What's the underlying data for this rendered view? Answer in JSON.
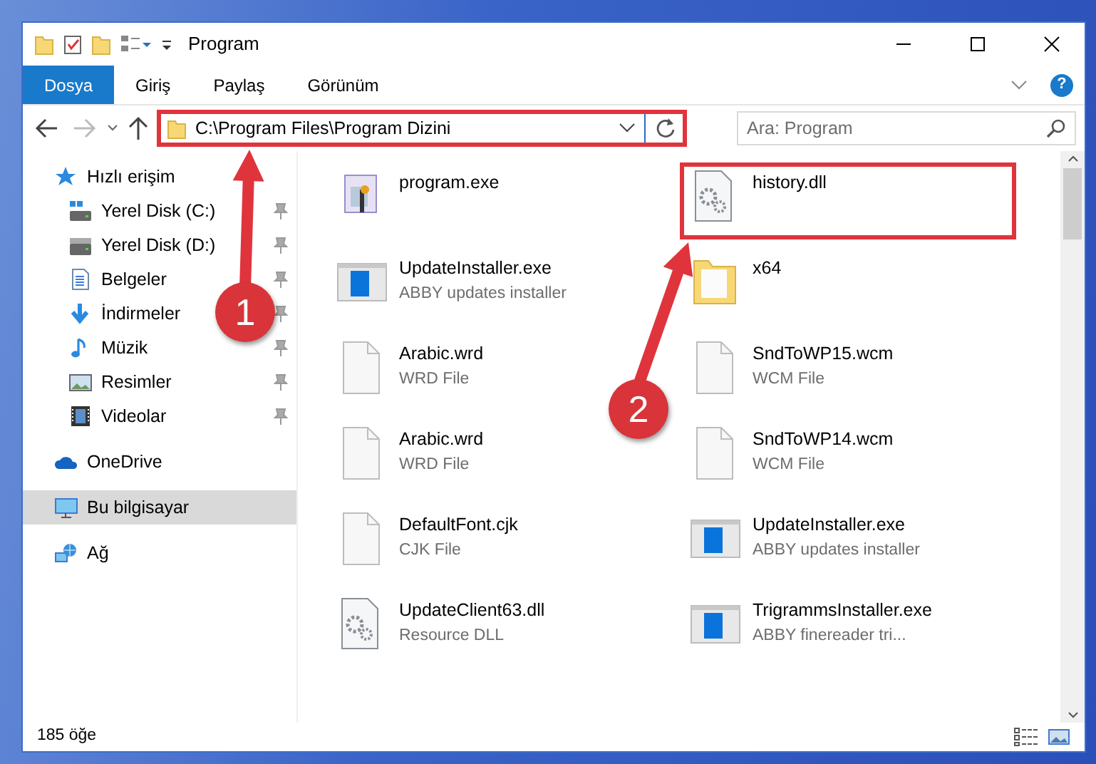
{
  "window": {
    "title": "Program",
    "help": "?"
  },
  "ribbon_tabs": [
    {
      "label": "Dosya",
      "selected": true
    },
    {
      "label": "Giriş",
      "selected": false
    },
    {
      "label": "Paylaş",
      "selected": false
    },
    {
      "label": "Görünüm",
      "selected": false
    }
  ],
  "address": {
    "path": "C:\\Program Files\\Program Dizini",
    "highlighted": true
  },
  "search": {
    "placeholder": "Ara: Program"
  },
  "sidebar": {
    "items": [
      {
        "label": "Hızlı erişim",
        "kind": "star",
        "selected": false,
        "children": [
          {
            "label": "Yerel Disk (C:)",
            "kind": "drive-c",
            "selected": false,
            "pinned": true
          },
          {
            "label": "Yerel Disk (D:)",
            "kind": "drive",
            "selected": false,
            "pinned": true
          },
          {
            "label": "Belgeler",
            "kind": "documents",
            "selected": false,
            "pinned": true
          },
          {
            "label": "İndirmeler",
            "kind": "download",
            "selected": false,
            "pinned": true
          },
          {
            "label": "Müzik",
            "kind": "music",
            "selected": false,
            "pinned": true
          },
          {
            "label": "Resimler",
            "kind": "pictures",
            "selected": false,
            "pinned": true
          },
          {
            "label": "Videolar",
            "kind": "videos",
            "selected": false,
            "pinned": true
          }
        ]
      },
      {
        "label": "OneDrive",
        "kind": "cloud",
        "selected": false
      },
      {
        "label": "Bu bilgisayar",
        "kind": "computer",
        "selected": true
      },
      {
        "label": "Ağ",
        "kind": "network",
        "selected": false
      }
    ]
  },
  "files": [
    {
      "name": "program.exe",
      "kind": "app",
      "highlighted": false
    },
    {
      "name": "history.dll",
      "kind": "gear-file",
      "highlighted": true
    },
    {
      "name": "UpdateInstaller.exe",
      "type": "ABBY updates installer",
      "kind": "installer",
      "highlighted": false
    },
    {
      "name": "x64",
      "kind": "folder",
      "highlighted": false
    },
    {
      "name": "Arabic.wrd",
      "type": "WRD File",
      "kind": "file",
      "highlighted": false
    },
    {
      "name": "SndToWP15.wcm",
      "type": "WCM File",
      "kind": "file",
      "highlighted": false
    },
    {
      "name": "Arabic.wrd",
      "type": "WRD File",
      "kind": "file",
      "highlighted": false
    },
    {
      "name": "SndToWP14.wcm",
      "type": "WCM File",
      "kind": "file",
      "highlighted": false
    },
    {
      "name": "DefaultFont.cjk",
      "type": "CJK File",
      "kind": "file",
      "highlighted": false
    },
    {
      "name": "UpdateInstaller.exe",
      "type": "ABBY updates installer",
      "kind": "installer",
      "highlighted": false
    },
    {
      "name": "UpdateClient63.dll",
      "type": "Resource DLL",
      "kind": "gear-file",
      "highlighted": false
    },
    {
      "name": "TrigrammsInstaller.exe",
      "type": "ABBY finereader tri...",
      "kind": "installer",
      "highlighted": false
    }
  ],
  "status_bar": {
    "count": "185 öğe"
  },
  "annotations": [
    {
      "number": "1"
    },
    {
      "number": "2"
    }
  ]
}
